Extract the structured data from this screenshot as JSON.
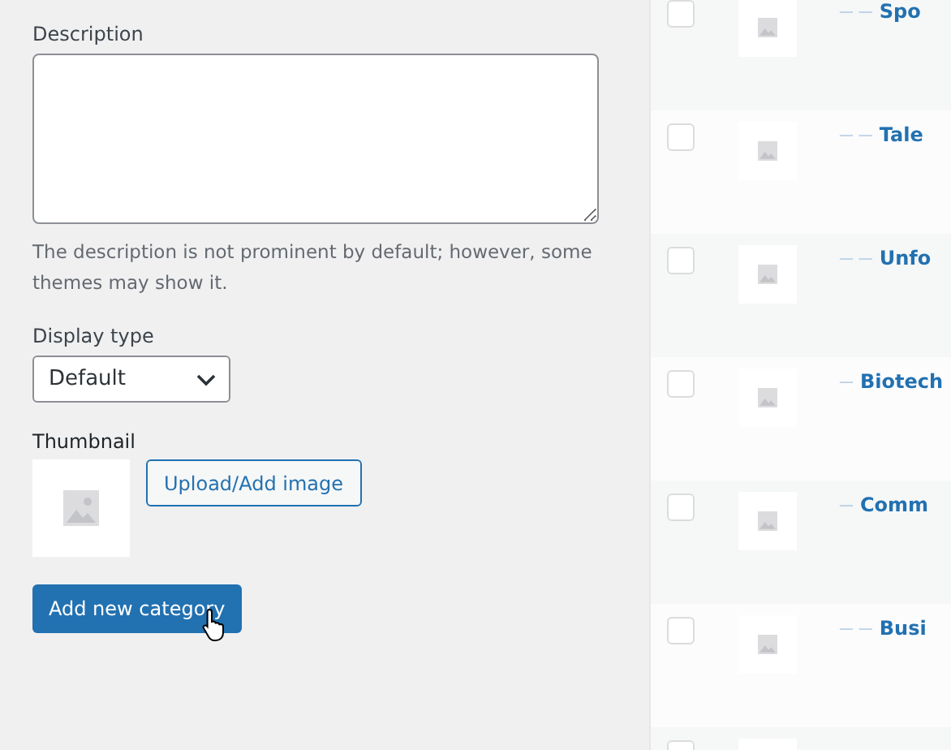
{
  "form": {
    "description": {
      "label": "Description",
      "help": "The description is not prominent by default; however, some themes may show it."
    },
    "display_type": {
      "label": "Display type",
      "value": "Default"
    },
    "thumbnail": {
      "label": "Thumbnail",
      "upload_button": "Upload/Add image"
    },
    "submit_button": "Add new category"
  },
  "category_rows": [
    {
      "dashes": "— —",
      "name": "Spo",
      "checked": false
    },
    {
      "dashes": "— —",
      "name": "Tale",
      "checked": false
    },
    {
      "dashes": "— —",
      "name": "Unfo",
      "checked": false
    },
    {
      "dashes": "—",
      "name": "Biotech",
      "checked": false
    },
    {
      "dashes": "—",
      "name": "Comm",
      "checked": false
    },
    {
      "dashes": "— —",
      "name": "Busi",
      "checked": false
    },
    {
      "checked": false
    }
  ]
}
